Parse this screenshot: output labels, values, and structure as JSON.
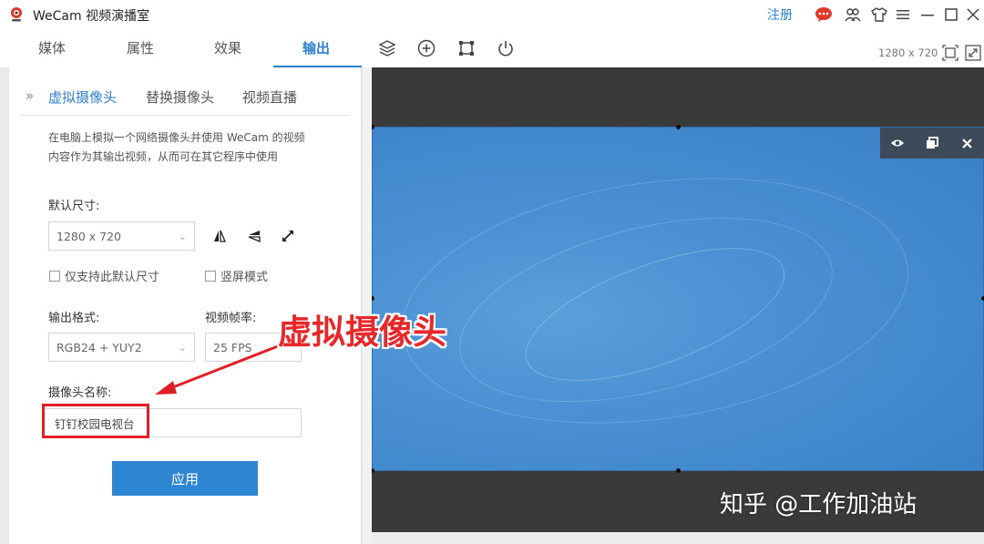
{
  "app": {
    "title": "WeCam 视频演播室",
    "register_label": "注册"
  },
  "main_tabs": [
    {
      "label": "媒体"
    },
    {
      "label": "属性"
    },
    {
      "label": "效果"
    },
    {
      "label": "输出"
    }
  ],
  "sub_tabs": [
    {
      "label": "虚拟摄像头"
    },
    {
      "label": "替换摄像头"
    },
    {
      "label": "视频直播"
    }
  ],
  "panel": {
    "description_line1": "在电脑上模拟一个网络摄像头并使用 WeCam 的视频",
    "description_line2": "内容作为其输出视频，从而可在其它程序中使用",
    "default_size_label": "默认尺寸:",
    "default_size_value": "1280 x 720",
    "only_default_label": "仅支持此默认尺寸",
    "portrait_label": "竖屏模式",
    "output_format_label": "输出格式:",
    "output_format_value": "RGB24 + YUY2",
    "frame_rate_label": "视频帧率:",
    "frame_rate_value": "25 FPS",
    "camera_name_label": "摄像头名称:",
    "camera_name_value": "钉钉校园电视台",
    "apply_label": "应用"
  },
  "toolbar": {
    "resolution": "1280 x 720"
  },
  "annotations": {
    "callout": "虚拟摄像头",
    "watermark": "知乎 @工作加油站"
  },
  "icons": [
    "webcam-icon",
    "chat-icon",
    "users-icon",
    "shirt-icon",
    "menu-icon",
    "minimize-icon",
    "maximize-icon",
    "close-icon",
    "layers-icon",
    "add-circle-icon",
    "crop-icon",
    "power-icon",
    "fit-icon",
    "fullscreen-icon",
    "eye-icon",
    "restore-icon",
    "remove-icon"
  ],
  "colors": {
    "accent": "#2f7fd1",
    "annotation_red": "#e01f26",
    "preview_blue": "#4a90d2"
  }
}
